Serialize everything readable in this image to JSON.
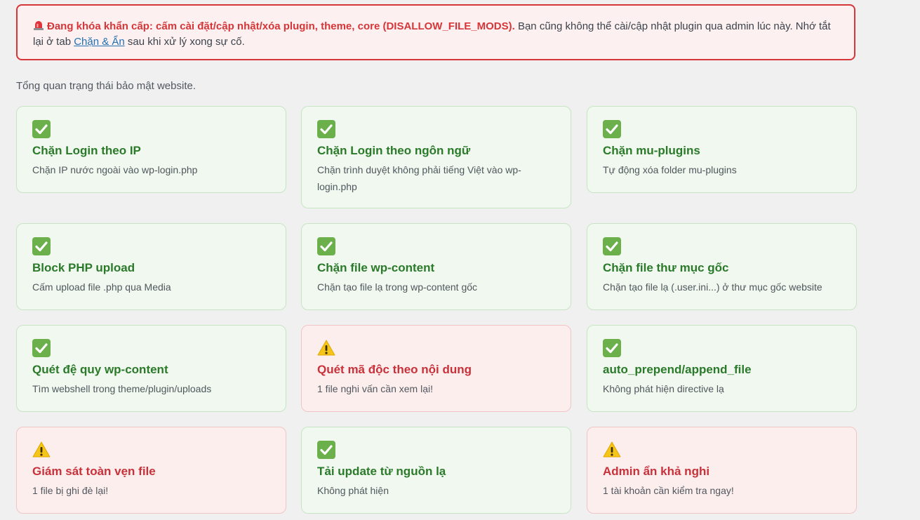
{
  "alert": {
    "strong_text": "Đang khóa khẩn cấp: cấm cài đặt/cập nhật/xóa plugin, theme, core (DISALLOW_FILE_MODS).",
    "text_part1": " Bạn cũng không thể cài/cập nhật plugin qua admin lúc này. Nhớ tắt lại ở tab ",
    "link_text": "Chặn & Ẩn",
    "text_part2": " sau khi xử lý xong sự cố.",
    "icon": "siren-icon"
  },
  "intro": "Tổng quan trạng thái bảo mật website.",
  "colors": {
    "ok_title": "#2a7a2a",
    "warn_title": "#c9313a",
    "alert_border": "#d63638",
    "check_bg": "#6bb04b"
  },
  "cards": [
    {
      "status": "ok",
      "icon": "check-icon",
      "title": "Chặn Login theo IP",
      "desc": "Chặn IP nước ngoài vào wp-login.php"
    },
    {
      "status": "ok",
      "icon": "check-icon",
      "title": "Chặn Login theo ngôn ngữ",
      "desc": "Chặn trình duyệt không phải tiếng Việt vào wp-login.php"
    },
    {
      "status": "ok",
      "icon": "check-icon",
      "title": "Chặn mu-plugins",
      "desc": "Tự động xóa folder mu-plugins"
    },
    {
      "status": "ok",
      "icon": "check-icon",
      "title": "Block PHP upload",
      "desc": "Cấm upload file .php qua Media"
    },
    {
      "status": "ok",
      "icon": "check-icon",
      "title": "Chặn file wp-content",
      "desc": "Chặn tạo file lạ trong wp-content gốc"
    },
    {
      "status": "ok",
      "icon": "check-icon",
      "title": "Chặn file thư mục gốc",
      "desc": "Chặn tạo file lạ (.user.ini...) ở thư mục gốc website"
    },
    {
      "status": "ok",
      "icon": "check-icon",
      "title": "Quét đệ quy wp-content",
      "desc": "Tìm webshell trong theme/plugin/uploads"
    },
    {
      "status": "warn",
      "icon": "warning-icon",
      "title": "Quét mã độc theo nội dung",
      "desc": "1 file nghi vấn cần xem lại!"
    },
    {
      "status": "ok",
      "icon": "check-icon",
      "title": "auto_prepend/append_file",
      "desc": "Không phát hiện directive lạ"
    },
    {
      "status": "warn",
      "icon": "warning-icon",
      "title": "Giám sát toàn vẹn file",
      "desc": "1 file bị ghi đè lại!"
    },
    {
      "status": "ok",
      "icon": "check-icon",
      "title": "Tải update từ nguồn lạ",
      "desc": "Không phát hiện"
    },
    {
      "status": "warn",
      "icon": "warning-icon",
      "title": "Admin ẩn khả nghi",
      "desc": "1 tài khoản cần kiểm tra ngay!"
    }
  ]
}
